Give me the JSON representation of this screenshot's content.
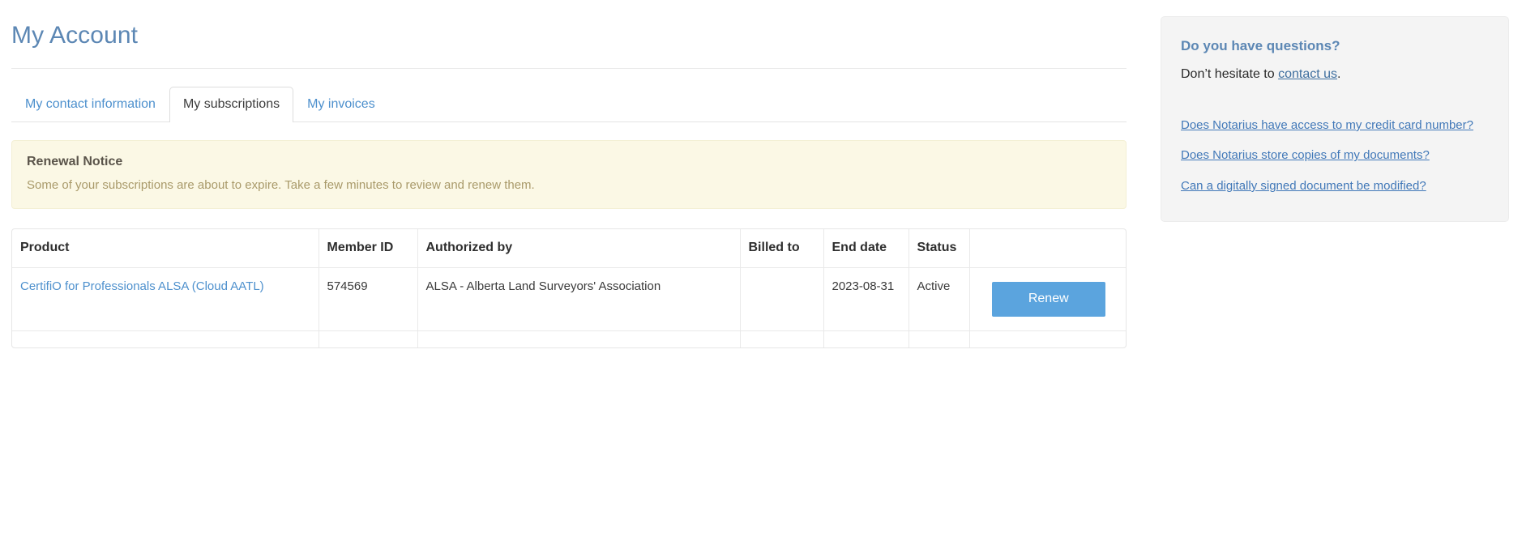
{
  "page": {
    "title": "My Account"
  },
  "tabs": [
    {
      "label": "My contact information",
      "active": false
    },
    {
      "label": "My subscriptions",
      "active": true
    },
    {
      "label": "My invoices",
      "active": false
    }
  ],
  "notice": {
    "title": "Renewal Notice",
    "body": "Some of your subscriptions are about to expire. Take a few minutes to review and renew them.",
    "background_color": "#fbf8e5",
    "text_color": "#a99a6a"
  },
  "subscriptions_table": {
    "columns": [
      "Product",
      "Member ID",
      "Authorized by",
      "Billed to",
      "End date",
      "Status",
      ""
    ],
    "rows": [
      {
        "product": "CertifiO for Professionals ALSA (Cloud AATL)",
        "member_id": "574569",
        "authorized_by": "ALSA - Alberta Land Surveyors' Association",
        "billed_to": "",
        "end_date": "2023-08-31",
        "status": "Active",
        "action_label": "Renew"
      }
    ],
    "action_button_color": "#5ba4de"
  },
  "sidebar": {
    "title": "Do you have questions?",
    "intro_prefix": "Don’t hesitate to ",
    "intro_link": "contact us",
    "intro_suffix": ".",
    "faq_links": [
      "Does Notarius have access to my credit card number?",
      "Does Notarius store copies of my documents?",
      "Can a digitally signed document be modified?"
    ],
    "background_color": "#f4f4f4"
  }
}
